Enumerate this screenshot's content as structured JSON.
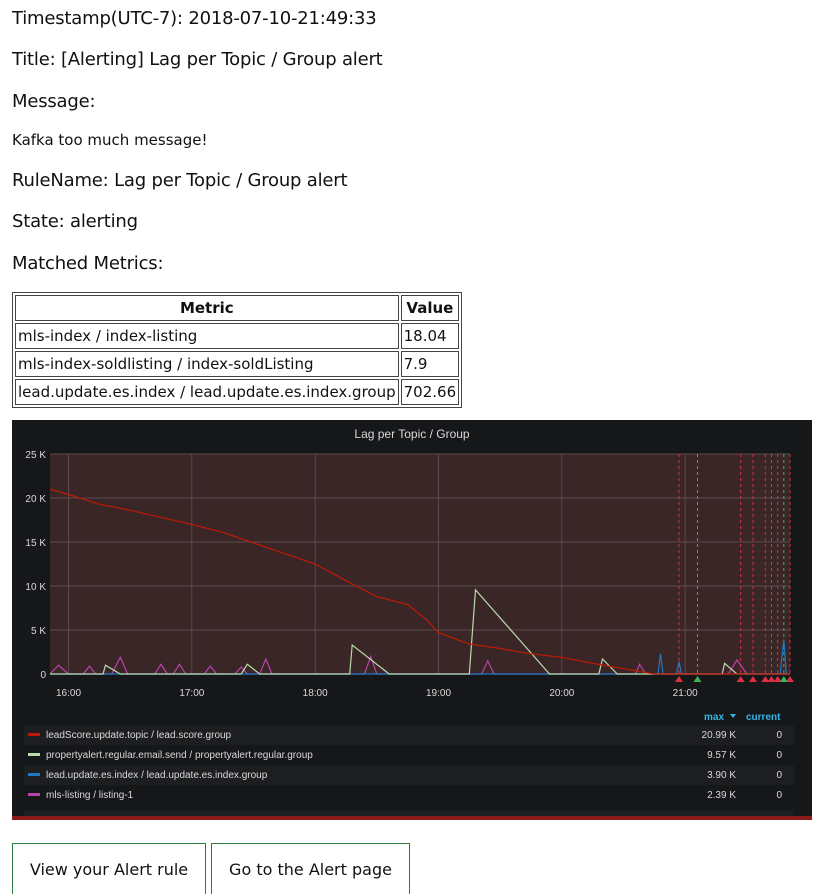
{
  "alert": {
    "timestamp": "Timestamp(UTC-7): 2018-07-10-21:49:33",
    "title": "Title: [Alerting] Lag per Topic / Group alert",
    "message_label": "Message:",
    "message": "Kafka too much message!",
    "rule_name": "RuleName: Lag per Topic / Group alert",
    "state": "State: alerting",
    "matched_label": "Matched Metrics:"
  },
  "metrics_table": {
    "headers": [
      "Metric",
      "Value"
    ],
    "rows": [
      [
        "mls-index / index-listing",
        "18.04"
      ],
      [
        "mls-index-soldlisting / index-soldListing",
        "7.9"
      ],
      [
        "lead.update.es.index / lead.update.es.index.group",
        "702.66"
      ]
    ]
  },
  "chart_data": {
    "type": "line",
    "title": "Lag per Topic / Group",
    "xlabel": "",
    "ylabel": "",
    "x_ticks": [
      "16:00",
      "17:00",
      "18:00",
      "19:00",
      "20:00",
      "21:00"
    ],
    "y_ticks": [
      "0",
      "5 K",
      "10 K",
      "15 K",
      "20 K",
      "25 K"
    ],
    "ylim": [
      0,
      25000
    ],
    "xlim_hours": [
      15.85,
      21.85
    ],
    "grid": true,
    "legend_placement": "bottom-table",
    "legend_columns": [
      "max",
      "current"
    ],
    "sort_indicator": "max-desc",
    "series": [
      {
        "name": "leadScore.update.topic / lead.score.group",
        "color": "#bf1b00",
        "max": "20.99 K",
        "current": "0",
        "points": [
          [
            15.85,
            20990
          ],
          [
            16,
            20400
          ],
          [
            16.25,
            19300
          ],
          [
            16.5,
            18600
          ],
          [
            16.75,
            17800
          ],
          [
            17,
            17000
          ],
          [
            17.25,
            16100
          ],
          [
            17.5,
            14900
          ],
          [
            17.75,
            13700
          ],
          [
            18,
            12500
          ],
          [
            18.25,
            10600
          ],
          [
            18.5,
            8800
          ],
          [
            18.75,
            7900
          ],
          [
            18.9,
            6200
          ],
          [
            19,
            4700
          ],
          [
            19.25,
            3400
          ],
          [
            19.5,
            2900
          ],
          [
            19.75,
            2300
          ],
          [
            20,
            1900
          ],
          [
            20.25,
            1200
          ],
          [
            20.5,
            600
          ],
          [
            20.75,
            0
          ],
          [
            21,
            0
          ],
          [
            21.5,
            0
          ],
          [
            21.85,
            0
          ]
        ]
      },
      {
        "name": "propertyalert.regular.email.send / propertyalert.regular.group",
        "color": "#b7dbab",
        "max": "9.57 K",
        "current": "0",
        "points": [
          [
            15.85,
            0
          ],
          [
            16.28,
            0
          ],
          [
            16.3,
            1000
          ],
          [
            16.42,
            0
          ],
          [
            17.4,
            0
          ],
          [
            17.45,
            1100
          ],
          [
            17.55,
            0
          ],
          [
            18.28,
            0
          ],
          [
            18.3,
            3300
          ],
          [
            18.6,
            0
          ],
          [
            19.25,
            0
          ],
          [
            19.3,
            9570
          ],
          [
            19.9,
            0
          ],
          [
            20.3,
            0
          ],
          [
            20.33,
            1700
          ],
          [
            20.45,
            0
          ],
          [
            21.3,
            0
          ],
          [
            21.32,
            1200
          ],
          [
            21.42,
            0
          ],
          [
            21.85,
            0
          ]
        ]
      },
      {
        "name": "lead.update.es.index / lead.update.es.index.group",
        "color": "#1f78c1",
        "max": "3.90 K",
        "current": "0",
        "points": [
          [
            15.85,
            0
          ],
          [
            20.78,
            0
          ],
          [
            20.8,
            2300
          ],
          [
            20.82,
            0
          ],
          [
            20.93,
            0
          ],
          [
            20.95,
            1400
          ],
          [
            20.97,
            0
          ],
          [
            21.77,
            0
          ],
          [
            21.8,
            3900
          ],
          [
            21.82,
            0
          ],
          [
            21.85,
            0
          ]
        ]
      },
      {
        "name": "mls-listing / listing-1",
        "color": "#ba43a9",
        "max": "2.39 K",
        "current": "0",
        "points": [
          [
            15.85,
            0
          ],
          [
            15.92,
            1000
          ],
          [
            16,
            0
          ],
          [
            16.12,
            0
          ],
          [
            16.17,
            900
          ],
          [
            16.22,
            0
          ],
          [
            16.35,
            0
          ],
          [
            16.42,
            1900
          ],
          [
            16.48,
            0
          ],
          [
            16.7,
            0
          ],
          [
            16.75,
            1100
          ],
          [
            16.8,
            0
          ],
          [
            16.85,
            0
          ],
          [
            16.9,
            1100
          ],
          [
            16.95,
            0
          ],
          [
            17.1,
            0
          ],
          [
            17.15,
            900
          ],
          [
            17.2,
            0
          ],
          [
            17.35,
            0
          ],
          [
            17.4,
            800
          ],
          [
            17.45,
            0
          ],
          [
            17.55,
            0
          ],
          [
            17.6,
            1700
          ],
          [
            17.65,
            0
          ],
          [
            18.4,
            0
          ],
          [
            18.45,
            2000
          ],
          [
            18.5,
            0
          ],
          [
            19.35,
            0
          ],
          [
            19.4,
            1500
          ],
          [
            19.45,
            0
          ],
          [
            20.6,
            0
          ],
          [
            20.63,
            1100
          ],
          [
            20.68,
            0
          ],
          [
            21.35,
            0
          ],
          [
            21.42,
            1600
          ],
          [
            21.5,
            0
          ],
          [
            21.85,
            0
          ]
        ]
      }
    ],
    "legend_overflow_row": {
      "name": "leadScore.update.topic / lead.score.group (partial)",
      "value": "…"
    },
    "alert_markers": {
      "red": [
        20.95,
        21.45,
        21.55,
        21.65,
        21.7,
        21.75,
        21.85
      ],
      "green": [
        21.1,
        21.8
      ]
    }
  },
  "buttons": {
    "view_rule": "View your Alert rule",
    "go_alert": "Go to the Alert page"
  }
}
